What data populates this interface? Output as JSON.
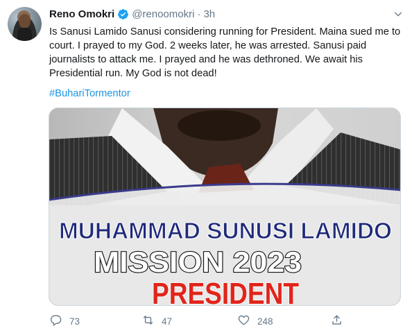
{
  "tweet": {
    "author_name": "Reno Omokri",
    "handle": "@renoomokri",
    "separator": "·",
    "time": "3h",
    "text": "Is Sanusi Lamido Sanusi considering running for President. Maina sued me to court. I prayed to my God. 2 weeks later, he was arrested. Sanusi paid journalists to attack me. I prayed and he was dethroned. We await his Presidential run. My God is not dead!",
    "hashtag": "#BuhariTormentor"
  },
  "media": {
    "line1": "MUHAMMAD SUNUSI LAMIDO",
    "line2": "MISSION 2023",
    "line3": "PRESIDENT",
    "colors": {
      "line1": "#1f2a7a",
      "line2": "#ffffff",
      "line3": "#e0251b",
      "band": "#3a3a8c"
    }
  },
  "actions": {
    "reply_count": "73",
    "retweet_count": "47",
    "like_count": "248"
  },
  "icons": {
    "verified": "verified-badge-icon",
    "caret": "chevron-down-icon",
    "reply": "reply-icon",
    "retweet": "retweet-icon",
    "like": "heart-icon",
    "share": "share-icon"
  },
  "colors": {
    "link": "#1b95e0",
    "muted": "#657786",
    "text": "#14171a"
  }
}
